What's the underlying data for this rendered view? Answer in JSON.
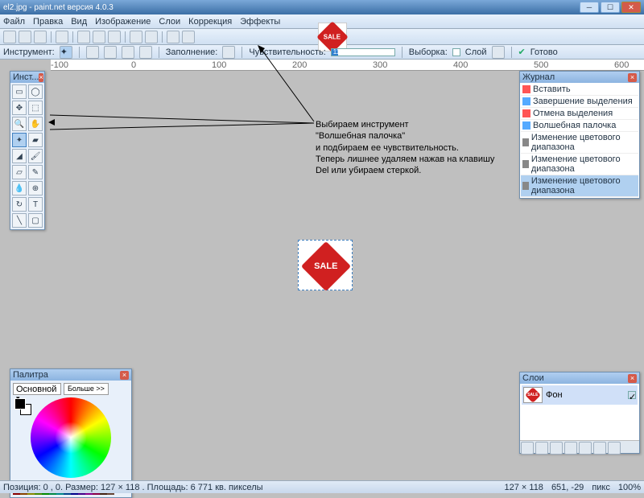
{
  "window": {
    "title": "el2.jpg - paint.net версия 4.0.3"
  },
  "menu": {
    "file": "Файл",
    "edit": "Правка",
    "view": "Вид",
    "image": "Изображение",
    "layers": "Слои",
    "adjust": "Коррекция",
    "effects": "Эффекты"
  },
  "toolopts": {
    "instrument": "Инструмент:",
    "fill": "Заполнение:",
    "tolerance": "Чувствительность:",
    "tolerance_value": "11%",
    "sample": "Выборка:",
    "layer": "Слой",
    "done": "Готово"
  },
  "ruler": {
    "m100": "-100",
    "p0": "0",
    "p100": "100",
    "p200": "200",
    "p300": "300",
    "p400": "400",
    "p500": "500",
    "p600": "600"
  },
  "panels": {
    "tools_title": "Инст...",
    "history_title": "Журнал",
    "palette_title": "Палитра",
    "layers_title": "Слои",
    "primary": "Основной",
    "more": "Больше >>",
    "layer_bg": "Фон"
  },
  "history": {
    "i1": "Вставить",
    "i2": "Завершение выделения",
    "i3": "Отмена выделения",
    "i4": "Волшебная палочка",
    "i5": "Изменение цветового диапазона",
    "i6": "Изменение цветового диапазона",
    "i7": "Изменение цветового диапазона"
  },
  "annotation": {
    "l1": "Выбираем инструмент",
    "l2": "\"Волшебная палочка\"",
    "l3": "и подбираем ее чувствительность.",
    "l4": "Теперь лишнее удаляем нажав на клавишу",
    "l5": "Del или убираем стеркой."
  },
  "sale": "SALE",
  "status": {
    "pos_size": "Позиция: 0 , 0. Размер: 127 × 118 . Площадь: 6 771 кв. пикселы",
    "dims": "127 × 118",
    "cursor": "651, -29",
    "unit": "пикс",
    "zoom": "100%"
  },
  "colors": {
    "swatches": [
      "#000",
      "#444",
      "#f00",
      "#f80",
      "#ff0",
      "#8f0",
      "#0f0",
      "#0f8",
      "#0ff",
      "#08f",
      "#00f",
      "#80f",
      "#f0f",
      "#f08",
      "#fff",
      "#ccc",
      "#800",
      "#840",
      "#880",
      "#480",
      "#080",
      "#084",
      "#088",
      "#048",
      "#008",
      "#408",
      "#808",
      "#804",
      "#421",
      "#643"
    ]
  }
}
